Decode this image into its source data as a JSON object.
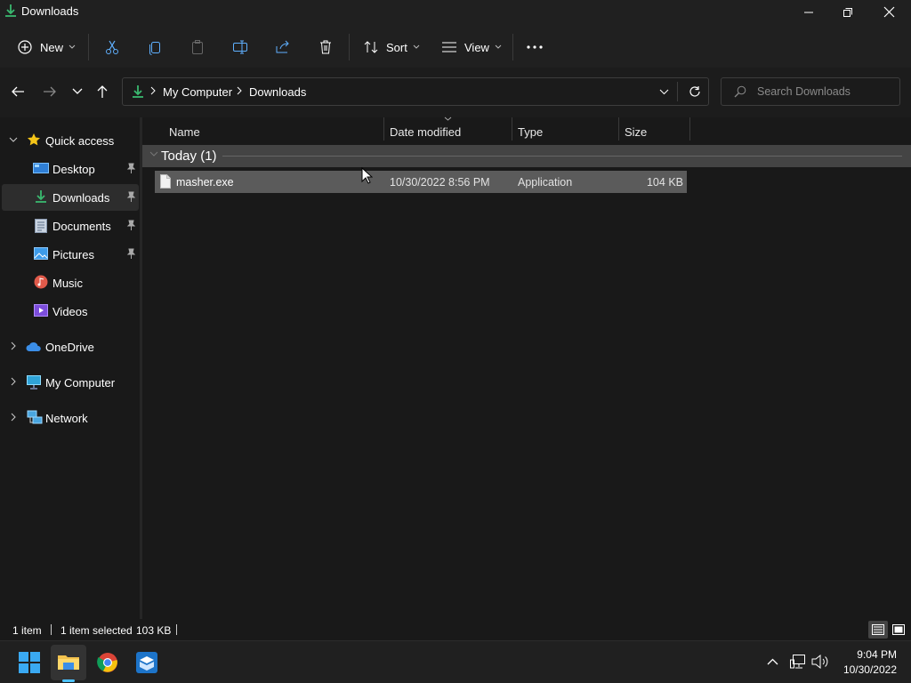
{
  "window": {
    "title": "Downloads"
  },
  "toolbar": {
    "new_label": "New",
    "sort_label": "Sort",
    "view_label": "View"
  },
  "address": {
    "crumbs": [
      "My Computer",
      "Downloads"
    ]
  },
  "search": {
    "placeholder": "Search Downloads"
  },
  "sidebar": {
    "quick_access": "Quick access",
    "items": [
      {
        "label": "Desktop",
        "pinned": true
      },
      {
        "label": "Downloads",
        "pinned": true
      },
      {
        "label": "Documents",
        "pinned": true
      },
      {
        "label": "Pictures",
        "pinned": true
      },
      {
        "label": "Music",
        "pinned": false
      },
      {
        "label": "Videos",
        "pinned": false
      }
    ],
    "roots": [
      "OneDrive",
      "My Computer",
      "Network"
    ]
  },
  "columns": {
    "name": "Name",
    "date": "Date modified",
    "type": "Type",
    "size": "Size"
  },
  "group": {
    "label": "Today (1)"
  },
  "files": [
    {
      "name": "masher.exe",
      "date": "10/30/2022 8:56 PM",
      "type": "Application",
      "size": "104 KB"
    }
  ],
  "status": {
    "count": "1 item",
    "selected": "1 item selected",
    "selected_size": "103 KB"
  },
  "taskbar": {
    "time": "9:04 PM",
    "date": "10/30/2022"
  },
  "colors": {
    "accent": "#4cc2ff",
    "folder": "#f3c24e",
    "download_green": "#3ab86f"
  }
}
